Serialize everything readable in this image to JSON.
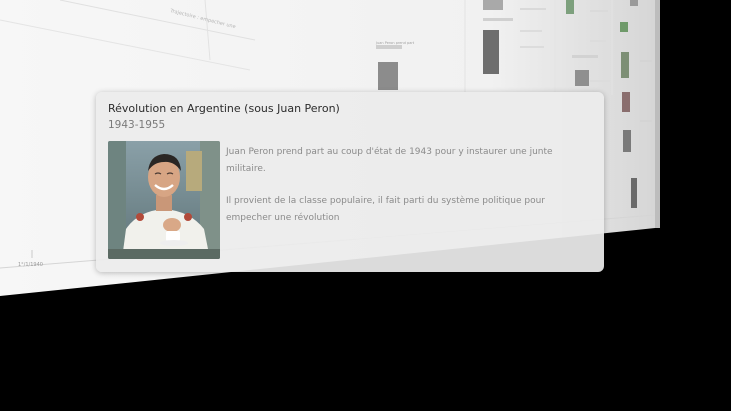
{
  "timeline": {
    "axis_tick_label": "1°/1/1940",
    "header_text": "Trajectoire : empecher une",
    "event_thumbnail_title": "Juan Peron prend part"
  },
  "event": {
    "title": "Révolution en Argentine (sous Juan Peron)",
    "dates": "1943-1955",
    "photo_description": "Portrait of Juan Peron in a white uniform, smiling while holding a cup",
    "paragraphs": [
      "Juan Peron prend part au coup d'état de 1943 pour y instaurer une junte militaire.",
      "Il provient de la classe populaire, il fait parti du système politique pour empecher une révolution"
    ]
  },
  "colors": {
    "background": "#000000",
    "plane": "#f4f4f4",
    "card": "#ececec"
  }
}
